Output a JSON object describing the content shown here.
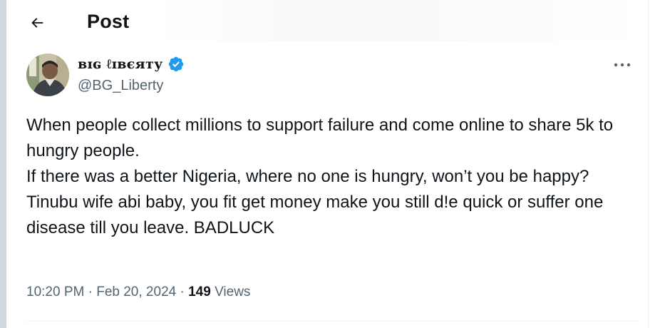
{
  "header": {
    "title": "Post",
    "back_icon": "arrow-left-icon"
  },
  "author": {
    "display_name": "ʙɪɢ ℓɪʙєяту",
    "handle": "@BG_Liberty",
    "verified": true,
    "verified_color": "#1d9bf0",
    "avatar_icon": "profile-photo"
  },
  "post": {
    "lines": [
      "When people collect millions to support failure and come online to share 5k to hungry people.",
      "If there was a better Nigeria, where no one is hungry, won’t you be happy?",
      "Tinubu wife abi baby, you fit get money make you still d!e quick or suffer one disease till you leave. BADLUCK"
    ]
  },
  "meta": {
    "time": "10:20 PM",
    "separator": " · ",
    "date": "Feb 20, 2024",
    "views_count": "149",
    "views_label": " Views"
  },
  "more_icon": "more-horizontal-icon"
}
